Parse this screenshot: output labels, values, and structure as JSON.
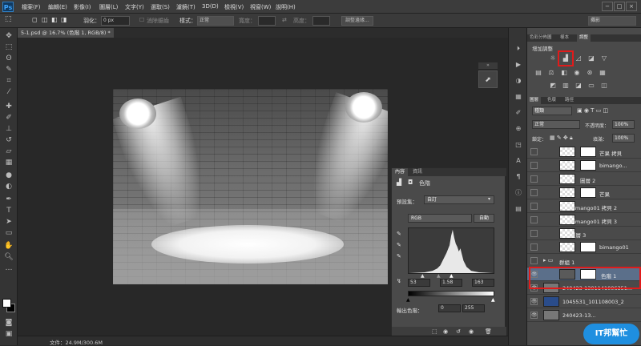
{
  "app": {
    "logo": "Ps"
  },
  "menu": [
    "檔案(F)",
    "編輯(E)",
    "影像(I)",
    "圖層(L)",
    "文字(Y)",
    "選取(S)",
    "濾鏡(T)",
    "3D(D)",
    "檢視(V)",
    "視窗(W)",
    "說明(H)"
  ],
  "window_controls": [
    "−",
    "□",
    "×"
  ],
  "options": {
    "feather_label": "羽化：",
    "feather_value": "0 px",
    "antialias_label": "消除鋸齒",
    "style_label": "樣式：",
    "style_value": "正常",
    "width_label": "寬度：",
    "height_label": "高度：",
    "refine_btn": "調整邊緣...",
    "workspace_value": "攝影"
  },
  "document": {
    "tab": "5-1.psd @ 16.7% (色階 1, RGB/8) *",
    "status": "文件：24.9M/300.6M"
  },
  "properties": {
    "tabs": [
      "內容",
      "資訊"
    ],
    "header": "色階",
    "preset_label": "預設集：",
    "preset_value": "自訂",
    "channel": "RGB",
    "auto_btn": "自動",
    "input_black": "53",
    "input_gamma": "1.58",
    "input_white": "163",
    "output_label": "輸出色階：",
    "output_black": "0",
    "output_white": "255"
  },
  "adjustments": {
    "tabs": [
      "色彩分佈圖",
      "樣本",
      "調整"
    ],
    "title": "增加調整"
  },
  "layers_panel": {
    "tabs": [
      "圖層",
      "色版",
      "路徑"
    ],
    "kind": "種類",
    "blend_mode": "正常",
    "opacity_label": "不透明度：",
    "opacity_value": "100%",
    "lock_label": "鎖定：",
    "fill_label": "填滿：",
    "fill_value": "100%",
    "layers": [
      {
        "name": "芒果 拷貝",
        "selected": false
      },
      {
        "name": "bimango...",
        "selected": false
      },
      {
        "name": "圖層 2",
        "selected": false
      },
      {
        "name": "芒果",
        "selected": false
      },
      {
        "name": "bimango01 拷貝 2",
        "selected": false
      },
      {
        "name": "bimango01 拷貝 3",
        "selected": false
      },
      {
        "name": "圖層 3",
        "selected": false
      },
      {
        "name": "bimango01",
        "selected": false
      },
      {
        "name": "群組 1",
        "selected": false
      },
      {
        "name": "色階 1",
        "selected": true
      },
      {
        "name": "240423-1301141006351...",
        "selected": false
      },
      {
        "name": "1045531_101108003_2",
        "selected": false
      },
      {
        "name": "240423-13...",
        "selected": false
      }
    ]
  },
  "watermark": "IT邦幫忙",
  "colors": {
    "highlight": "#e01b1b",
    "selected_layer": "#5b6f8a"
  }
}
